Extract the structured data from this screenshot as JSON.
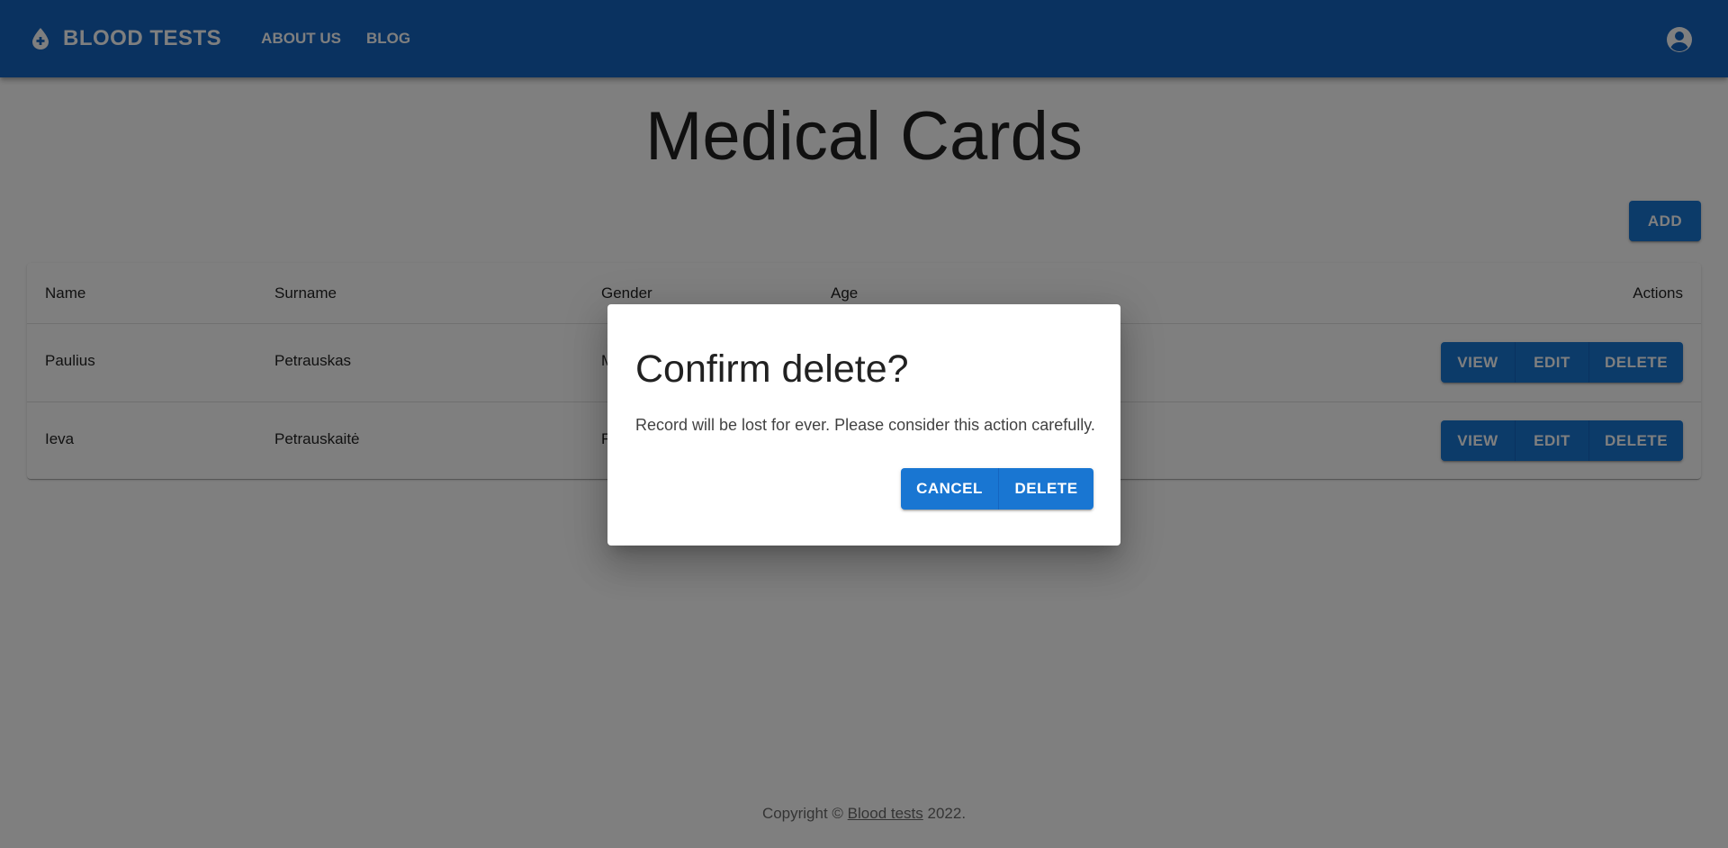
{
  "header": {
    "brand": "BLOOD TESTS",
    "nav": [
      "ABOUT US",
      "BLOG"
    ]
  },
  "page": {
    "title": "Medical Cards",
    "add_label": "ADD"
  },
  "table": {
    "columns": [
      "Name",
      "Surname",
      "Gender",
      "Age",
      "Actions"
    ],
    "rows": [
      {
        "name": "Paulius",
        "surname": "Petrauskas",
        "gender": "M",
        "age": ""
      },
      {
        "name": "Ieva",
        "surname": "Petrauskaitė",
        "gender": "F",
        "age": ""
      }
    ],
    "actions": [
      "VIEW",
      "EDIT",
      "DELETE"
    ]
  },
  "dialog": {
    "title": "Confirm delete?",
    "text": "Record will be lost for ever. Please consider this action carefully.",
    "cancel_label": "CANCEL",
    "delete_label": "DELETE"
  },
  "footer": {
    "prefix": "Copyright © ",
    "link": "Blood tests",
    "suffix": " 2022."
  },
  "colors": {
    "primary": "#1976d2",
    "appbar": "#1565c0",
    "backdrop": "rgba(0,0,0,0.5)"
  },
  "icons": {
    "brand": "blood-drop-icon",
    "account": "account-circle-icon"
  }
}
